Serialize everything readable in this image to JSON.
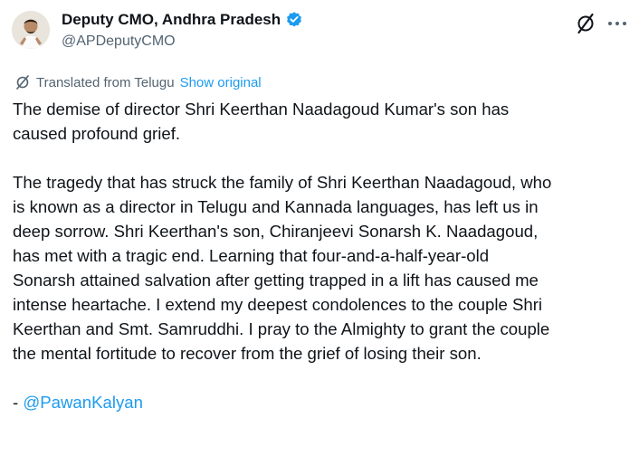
{
  "author": {
    "name": "Deputy CMO, Andhra Pradesh",
    "handle": "@APDeputyCMO",
    "verified_color": "#1d9bf0"
  },
  "header_actions": {
    "grok_icon": "grok-icon",
    "more_icon": "more-icon"
  },
  "translation": {
    "label": "Translated from Telugu",
    "show_original": "Show original"
  },
  "post": {
    "lines": [
      "The demise of director Shri Keerthan Naadagoud Kumar's son has",
      "caused profound grief.",
      "The tragedy that has struck the family of Shri Keerthan Naadagoud, who",
      "is known as a director in Telugu and Kannada languages, has left us in",
      "deep sorrow. Shri Keerthan's son, Chiranjeevi Sonarsh K. Naadagoud,",
      "has met with a tragic end. Learning that four-and-a-half-year-old",
      "Sonarsh attained salvation after getting trapped in a lift has caused me",
      "intense heartache. I extend my deepest condolences to the couple Shri",
      "Keerthan and Smt. Samruddhi. I pray to the Almighty to grant the couple",
      "the mental fortitude to recover from the grief of losing their son."
    ],
    "signature_prefix": "- ",
    "signature_mention": "@PawanKalyan"
  }
}
